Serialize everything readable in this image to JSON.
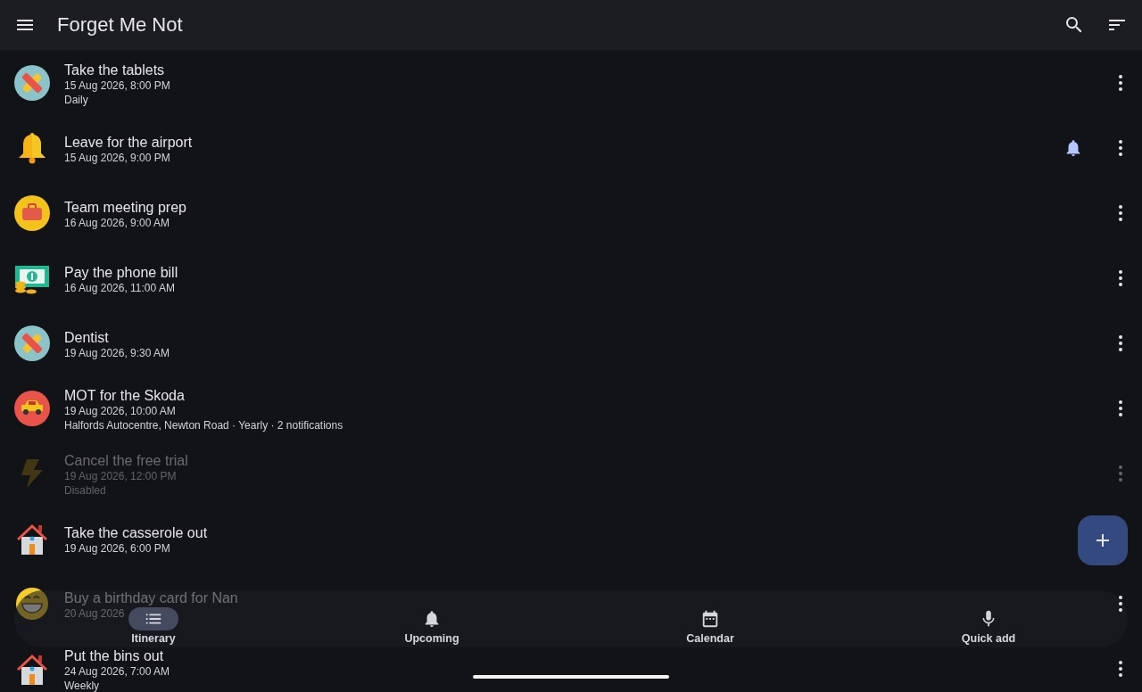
{
  "app_bar": {
    "title": "Forget Me Not"
  },
  "reminders": [
    {
      "kind": "bandage",
      "title": "Take the tablets",
      "time": "15 Aug 2026, 8:00 PM",
      "details": "Daily",
      "alarm": false,
      "disabled": false
    },
    {
      "kind": "bell",
      "title": "Leave for the airport",
      "time": "15 Aug 2026, 9:00 PM",
      "alarm": true,
      "disabled": false
    },
    {
      "kind": "briefcase",
      "title": "Team meeting prep",
      "time": "16 Aug 2026, 9:00 AM",
      "alarm": false,
      "disabled": false
    },
    {
      "kind": "money",
      "title": "Pay the phone bill",
      "time": "16 Aug 2026, 11:00 AM",
      "alarm": false,
      "disabled": false
    },
    {
      "kind": "bandage",
      "title": "Dentist",
      "time": "19 Aug 2026, 9:30 AM",
      "alarm": false,
      "disabled": false
    },
    {
      "kind": "car",
      "title": "MOT for the Skoda",
      "time": "19 Aug 2026, 10:00 AM",
      "details": "Halfords Autocentre, Newton Road · Yearly · 2 notifications",
      "alarm": false,
      "disabled": false
    },
    {
      "kind": "bolt",
      "title": "Cancel the free trial",
      "time": "19 Aug 2026, 12:00 PM",
      "details": "Disabled",
      "alarm": false,
      "disabled": true
    },
    {
      "kind": "house",
      "title": "Take the casserole out",
      "time": "19 Aug 2026, 6:00 PM",
      "alarm": false,
      "disabled": false
    },
    {
      "kind": "grin",
      "title": "Buy a birthday card for Nan",
      "time": "20 Aug 2026",
      "alarm": false,
      "disabled": false
    },
    {
      "kind": "house",
      "title": "Put the bins out",
      "time": "24 Aug 2026, 7:00 AM",
      "details": "Weekly",
      "alarm": false,
      "disabled": false
    }
  ],
  "nav": [
    {
      "kind": "list",
      "label": "Itinerary",
      "selected": true
    },
    {
      "kind": "bell",
      "label": "Upcoming",
      "selected": false
    },
    {
      "kind": "calendar",
      "label": "Calendar",
      "selected": false
    },
    {
      "kind": "mic",
      "label": "Quick add",
      "selected": false
    }
  ]
}
